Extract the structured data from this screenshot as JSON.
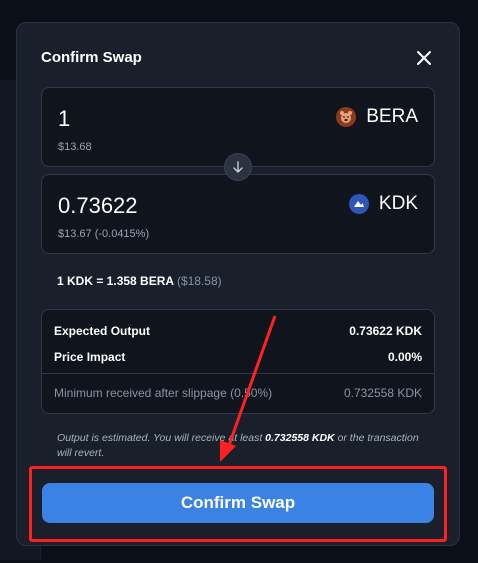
{
  "modal": {
    "title": "Confirm Swap"
  },
  "from": {
    "amount": "1",
    "usd": "$13.68",
    "token": "BERA",
    "icon": "bear-token-icon"
  },
  "to": {
    "amount": "0.73622",
    "usd": "$13.67 (-0.0415%)",
    "token": "KDK",
    "icon": "kdk-token-icon"
  },
  "rate": {
    "text": "1 KDK = 1.358 BERA",
    "usd": "($18.58)"
  },
  "details": {
    "expected_label": "Expected Output",
    "expected_value": "0.73622 KDK",
    "impact_label": "Price Impact",
    "impact_value": "0.00%",
    "min_label": "Minimum received after slippage (0.50%)",
    "min_value": "0.732558 KDK"
  },
  "note": {
    "prefix": "Output is estimated. You will receive at least ",
    "amount": "0.732558 KDK",
    "suffix": " or the transaction will revert."
  },
  "confirm_button": "Confirm Swap",
  "colors": {
    "accent": "#3a82e3",
    "highlight": "#ff2020",
    "bera_coin": "#8b3a1c",
    "kdk_coin": "#2e55b8"
  }
}
